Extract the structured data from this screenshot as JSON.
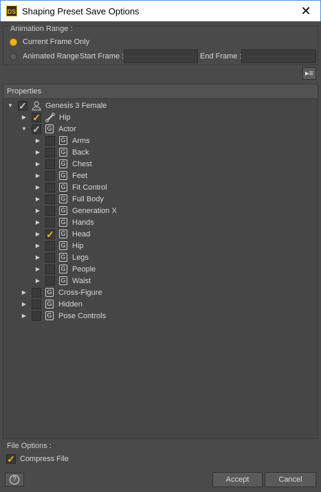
{
  "window": {
    "app_icon_text": "DS",
    "title": "Shaping Preset Save Options",
    "close_glyph": "✕"
  },
  "animation_range": {
    "group_label": "Animation Range :",
    "current_frame_label": "Current Frame Only",
    "animated_range_label": "Animated Range",
    "start_frame_label": "Start Frame :",
    "end_frame_label": "End Frame :",
    "selected": "Current Frame Only"
  },
  "toolbar": {
    "menu_icon": "list-menu-icon",
    "glyph": "▸≡"
  },
  "properties": {
    "header": "Properties",
    "tree": [
      {
        "label": "Genesis 3 Female",
        "arrow": "▼",
        "check": "✓",
        "icon": "figure"
      },
      {
        "label": "Hip",
        "arrow": "▶",
        "check": "✓",
        "icon": "bone"
      },
      {
        "label": "Actor",
        "arrow": "▼",
        "check": "✓",
        "icon": "G"
      },
      {
        "label": "Arms",
        "arrow": "▶",
        "check": "",
        "icon": "G"
      },
      {
        "label": "Back",
        "arrow": "▶",
        "check": "",
        "icon": "G"
      },
      {
        "label": "Chest",
        "arrow": "▶",
        "check": "",
        "icon": "G"
      },
      {
        "label": "Feet",
        "arrow": "▶",
        "check": "",
        "icon": "G"
      },
      {
        "label": "Fit Control",
        "arrow": "▶",
        "check": "",
        "icon": "G"
      },
      {
        "label": "Full Body",
        "arrow": "▶",
        "check": "",
        "icon": "G"
      },
      {
        "label": "Generation X",
        "arrow": "▶",
        "check": "",
        "icon": "G"
      },
      {
        "label": "Hands",
        "arrow": "▶",
        "check": "",
        "icon": "G"
      },
      {
        "label": "Head",
        "arrow": "▶",
        "check": "✓",
        "icon": "G"
      },
      {
        "label": "Hip",
        "arrow": "▶",
        "check": "",
        "icon": "G"
      },
      {
        "label": "Legs",
        "arrow": "▶",
        "check": "",
        "icon": "G"
      },
      {
        "label": "People",
        "arrow": "▶",
        "check": "",
        "icon": "G"
      },
      {
        "label": "Waist",
        "arrow": "▶",
        "check": "",
        "icon": "G"
      },
      {
        "label": "Cross-Figure",
        "arrow": "▶",
        "check": "",
        "icon": "G"
      },
      {
        "label": "Hidden",
        "arrow": "▶",
        "check": "",
        "icon": "G"
      },
      {
        "label": "Pose Controls",
        "arrow": "▶",
        "check": "",
        "icon": "G"
      }
    ]
  },
  "file_options": {
    "group_label": "File Options :",
    "compress_label": "Compress File",
    "compress_check": "✓"
  },
  "footer": {
    "help_glyph": "?",
    "accept_label": "Accept",
    "cancel_label": "Cancel"
  },
  "colors": {
    "accent": "#f2b51c",
    "background": "#4a4a4a",
    "panel": "#464646",
    "text": "#d8d8d8"
  }
}
